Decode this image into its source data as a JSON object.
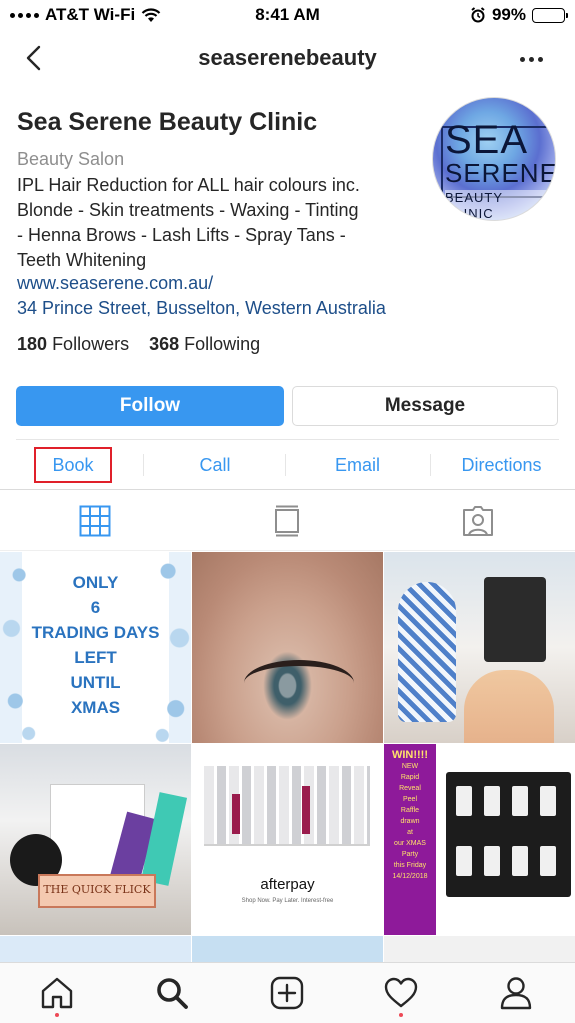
{
  "status_bar": {
    "carrier": "AT&T Wi-Fi",
    "time": "8:41 AM",
    "battery": "99%",
    "icons": [
      "signal-dots-icon",
      "wifi-icon",
      "alarm-icon",
      "battery-icon"
    ]
  },
  "nav": {
    "title": "seaserenebeauty",
    "icons": [
      "back-chevron-icon",
      "more-options-icon"
    ]
  },
  "profile": {
    "name": "Sea Serene Beauty Clinic",
    "category": "Beauty Salon",
    "bio_lines": [
      "IPL Hair Reduction for ALL hair colours inc.",
      "Blonde - Skin treatments - Waxing - Tinting",
      "- Henna Brows - Lash Lifts - Spray Tans -",
      "Teeth Whitening"
    ],
    "website": "www.seaserene.com.au/",
    "address": "34 Prince Street, Busselton, Western Australia",
    "followers_count": "180",
    "followers_label": "Followers",
    "following_count": "368",
    "following_label": "Following",
    "avatar_logo": {
      "line1": "SEA",
      "line2": "SERENE",
      "line3": "BEAUTY CLINIC"
    }
  },
  "buttons": {
    "follow": "Follow",
    "message": "Message"
  },
  "actions": {
    "book": "Book",
    "call": "Call",
    "email": "Email",
    "directions": "Directions",
    "highlight_color": "#e0202a"
  },
  "tabs": {
    "icons": [
      "grid-view-icon",
      "feed-view-icon",
      "tagged-photos-icon"
    ],
    "active": "grid-view-icon"
  },
  "grid": {
    "post1_lines": [
      "ONLY",
      "6",
      "TRADING DAYS",
      "LEFT",
      "UNTIL",
      "XMAS"
    ],
    "post4_text": "THE QUICK FLICK",
    "post5_text": "afterpay",
    "post5_tagline": "Shop Now. Pay Later. Interest-free",
    "post6_lines": [
      "WIN!!!!",
      "NEW",
      "Rapid",
      "Reveal",
      "Peel",
      "Raffle",
      "drawn",
      "at",
      "our XMAS",
      "Party",
      "this Friday",
      "14/12/2018"
    ]
  },
  "bottom_nav": {
    "icons": [
      "home-icon",
      "search-icon",
      "new-post-icon",
      "activity-heart-icon",
      "profile-icon"
    ],
    "active": "search-icon"
  },
  "colors": {
    "accent_blue": "#3897f0",
    "link_blue": "#1d4e89",
    "text": "#262626",
    "muted": "#8e8e8e",
    "notification_red": "#ed4956"
  }
}
